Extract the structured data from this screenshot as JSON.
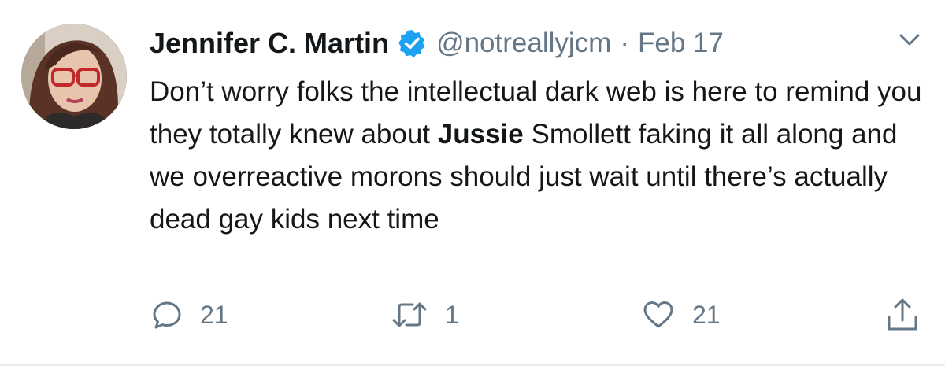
{
  "tweet": {
    "display_name": "Jennifer C. Martin",
    "handle": "@notreallyjcm",
    "separator": "·",
    "date": "Feb 17",
    "verified": true,
    "text_before": "Don’t worry folks the intellectual dark web is here to remind you they totally knew about ",
    "text_bold": "Jussie",
    "text_after": " Smollett faking it all along and we overreactive morons should just wait until there’s actually dead gay kids next time",
    "replies": "21",
    "retweets": "1",
    "likes": "21"
  },
  "icons": {
    "verified": "verified-badge-icon",
    "caret": "chevron-down-icon",
    "reply": "reply-bubble-icon",
    "retweet": "retweet-icon",
    "like": "heart-icon",
    "share": "share-icon"
  },
  "colors": {
    "text": "#14171a",
    "secondary": "#657786",
    "verified_blue": "#1da1f2",
    "divider": "#e6ecf0",
    "background": "#ffffff"
  }
}
